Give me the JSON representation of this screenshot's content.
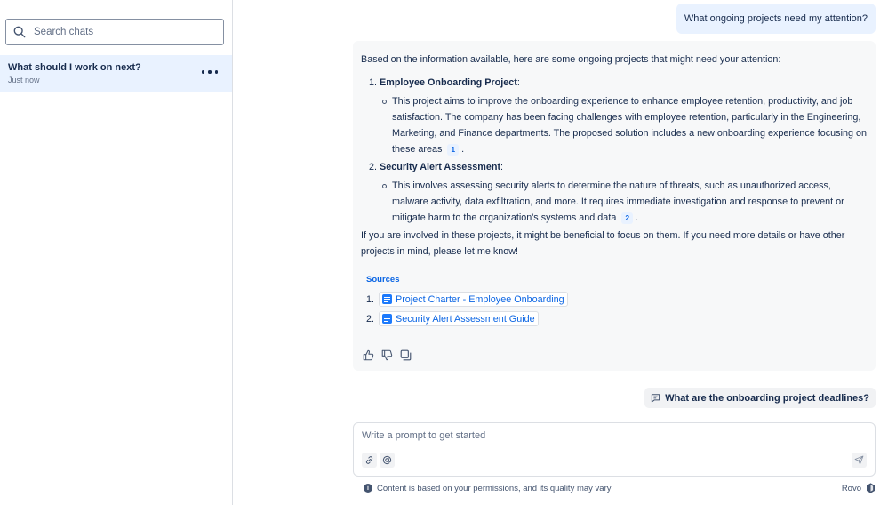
{
  "sidebar": {
    "search_placeholder": "Search chats",
    "chats": [
      {
        "title": "What should I work on next?",
        "time": "Just now",
        "active": true
      }
    ]
  },
  "conversation": {
    "user_message": "What ongoing projects need my attention?",
    "ai_response": {
      "intro": "Based on the information available, here are some ongoing projects that might need your attention:",
      "projects": [
        {
          "number": "1.",
          "title": "Employee Onboarding Project",
          "suffix": ":",
          "detail": "This project aims to improve the onboarding experience to enhance employee retention, productivity, and job satisfaction. The company has been facing challenges with employee retention, particularly in the Engineering, Marketing, and Finance departments. The proposed solution includes a new onboarding experience focusing on these areas",
          "citation": "1"
        },
        {
          "number": "2.",
          "title": "Security Alert Assessment",
          "suffix": ":",
          "detail": "This involves assessing security alerts to determine the nature of threats, such as unauthorized access, malware activity, data exfiltration, and more. It requires immediate investigation and response to prevent or mitigate harm to the organization's systems and data",
          "citation": "2"
        }
      ],
      "outro": "If you are involved in these projects, it might be beneficial to focus on them. If you need more details or have other projects in mind, please let me know!",
      "sources_title": "Sources",
      "sources": [
        {
          "number": "1.",
          "title": "Project Charter - Employee Onboarding",
          "icon": "document-icon"
        },
        {
          "number": "2.",
          "title": "Security Alert Assessment Guide",
          "icon": "document-icon"
        }
      ],
      "feedback_icons": [
        "thumbs-up-icon",
        "thumbs-down-icon",
        "copy-icon"
      ]
    },
    "suggestion": "What are the onboarding project deadlines?"
  },
  "composer": {
    "placeholder": "Write a prompt to get started",
    "value": "",
    "tools": [
      "link-icon",
      "mention-icon"
    ],
    "send_icon": "send-icon"
  },
  "footer": {
    "disclaimer": "Content is based on your permissions, and its quality may vary",
    "brand": "Rovo"
  },
  "colors": {
    "accent": "#0c66e4",
    "selected_bg": "#e9f2ff",
    "response_bg": "#f7f8f9",
    "text": "#172b4d"
  }
}
